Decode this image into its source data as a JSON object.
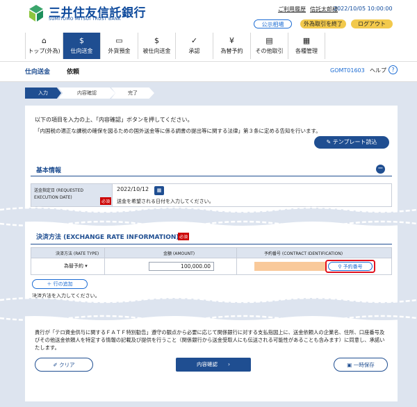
{
  "header": {
    "bank_name": "三井住友信託銀行",
    "bank_name_en": "SUMITOMO MITSUI TRUST BANK",
    "history_link": "ご利用履歴",
    "user_link": "信託太郎様",
    "datetime": "2022/10/05 10:00:00",
    "public_button": "公示相場",
    "fx_end_button": "外為取引を終了",
    "logout_button": "ログアウト"
  },
  "nav": {
    "items": [
      {
        "label": "トップ(外為)",
        "icon": "home-icon"
      },
      {
        "label": "仕向送金",
        "icon": "remit-icon"
      },
      {
        "label": "外貨預金",
        "icon": "deposit-icon"
      },
      {
        "label": "被仕向送金",
        "icon": "receive-icon"
      },
      {
        "label": "承認",
        "icon": "approve-icon"
      },
      {
        "label": "為替予約",
        "icon": "contract-icon"
      },
      {
        "label": "その他取引",
        "icon": "other-icon"
      },
      {
        "label": "各種管理",
        "icon": "manage-icon"
      }
    ]
  },
  "titlebar": {
    "crumb": "仕向送金",
    "title": "依頼",
    "screen_code": "GOMT01603",
    "help": "ヘルプ"
  },
  "steps": [
    "入力",
    "内容確認",
    "完了"
  ],
  "intro": {
    "line1": "以下の項目を入力の上、「内容確認」ボタンを押してください。",
    "line2": "「内国税の適正な課税の確保を図るための国外送金等に係る調書の提出等に関する法律」第３条に定める告知を行います。",
    "template_button": "テンプレート読込"
  },
  "basic": {
    "title": "基本情報",
    "date_label": "送金指定日 (REQUESTED EXECUTION DATE)",
    "required": "必須",
    "date_value": "2022/10/12",
    "date_hint": "送金を希望される日付を入力してください。"
  },
  "fx": {
    "title": "決済方法 (EXCHANGE RATE INFORMATION)",
    "required": "必須",
    "col_type": "決済方法 (RATE TYPE)",
    "col_amount": "金額 (AMOUNT)",
    "col_contract": "予約番号 (CONTRACT IDENTIFICATION)",
    "type_value": "為替予約",
    "amount_value": "100,000.00",
    "contract_button": "予約番号",
    "add_row": "行の追加",
    "hint": "決済方法を入力してください。"
  },
  "notice": "貴行が「テロ資金供与に関するＦＡＴＦ特別勧告」遵守の観点から必要に応じて関係銀行に対する支払指図上に、送金依頼人の企業名、住所、口座番号及びその他送金依頼人を特定する情報の記載及び提供を行うこと（関係銀行から送金受取人にも伝送される可能性があることも含みます）に同意し、承諾いたします。",
  "footer": {
    "clear": "クリア",
    "confirm": "内容確認",
    "save": "一時保存"
  },
  "colors": {
    "primary": "#1f4e91",
    "accent_yellow": "#f2c94c",
    "required_red": "#cc0000",
    "highlight_red": "#e1101d",
    "input_orange": "#f9c99a",
    "background": "#dde4ef"
  }
}
